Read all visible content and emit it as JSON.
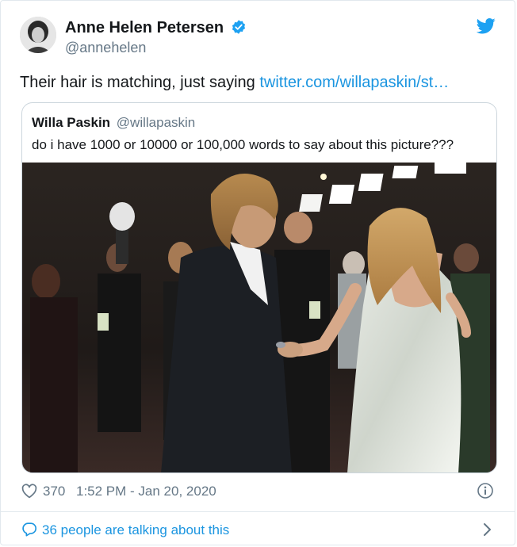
{
  "author": {
    "display_name": "Anne Helen Petersen",
    "handle": "@annehelen",
    "verified": true
  },
  "tweet": {
    "text": "Their hair is matching, just saying ",
    "link_text": "twitter.com/willapaskin/st…"
  },
  "quoted_tweet": {
    "display_name": "Willa Paskin",
    "handle": "@willapaskin",
    "text": "do i have 1000 or 10000 or 100,000 words to say about this picture???"
  },
  "footer": {
    "likes": "370",
    "timestamp": "1:52 PM - Jan 20, 2020"
  },
  "talking": {
    "label": "36 people are talking about this"
  },
  "colors": {
    "link": "#1b95e0",
    "secondary_text": "#657786",
    "border": "#e1e8ed"
  },
  "icons": [
    "verified-badge-icon",
    "twitter-bird-icon",
    "heart-icon",
    "info-icon",
    "speech-bubble-icon",
    "chevron-right-icon"
  ]
}
